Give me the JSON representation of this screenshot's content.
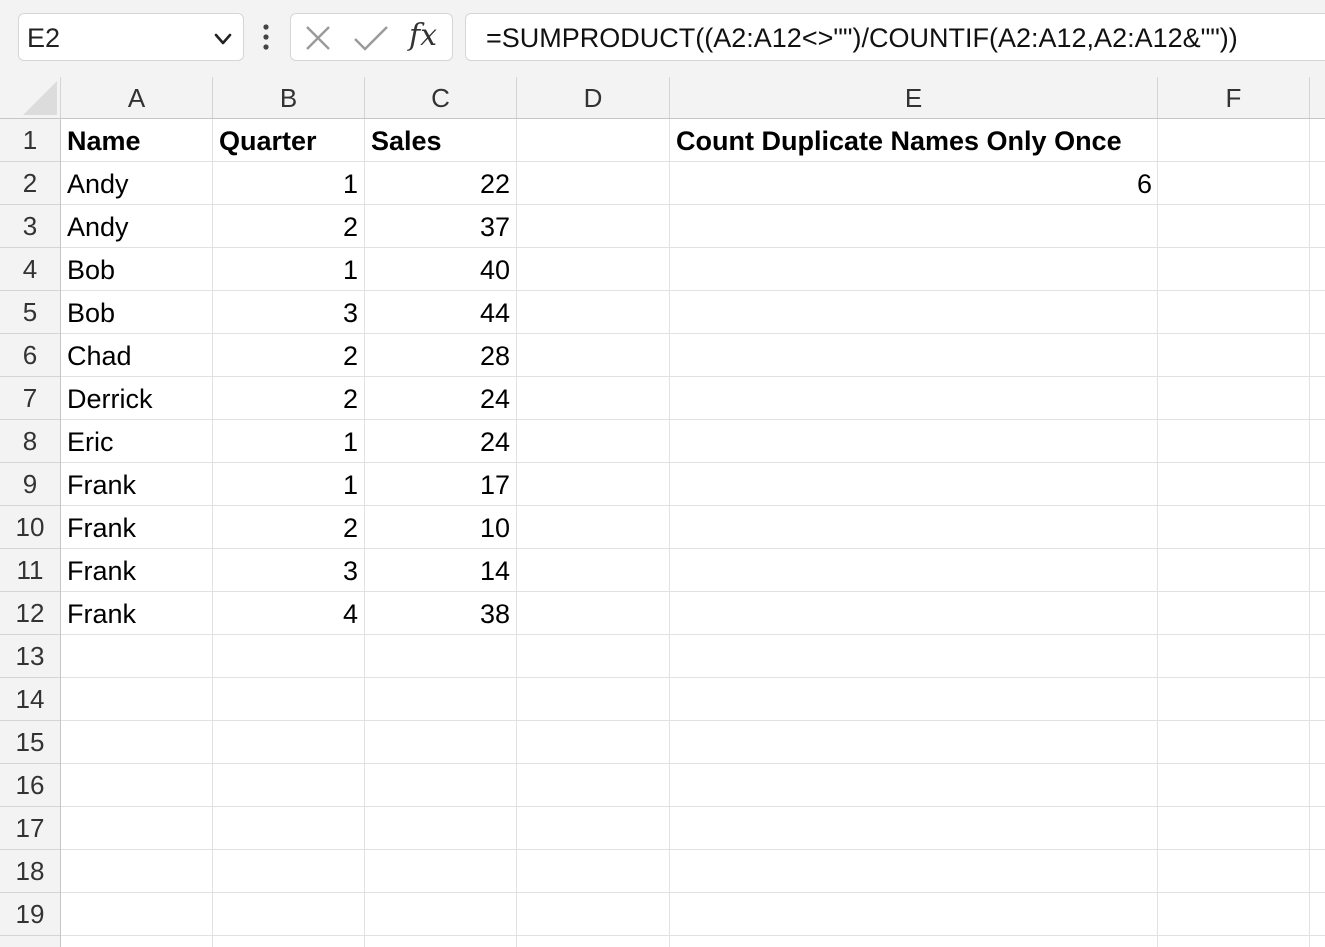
{
  "name_box": {
    "value": "E2"
  },
  "formula_bar": {
    "fx_label": "fx",
    "formula": "=SUMPRODUCT((A2:A12<>\"\")/COUNTIF(A2:A12,A2:A12&\"\"))"
  },
  "columns": [
    "A",
    "B",
    "C",
    "D",
    "E",
    "F"
  ],
  "rows": [
    "1",
    "2",
    "3",
    "4",
    "5",
    "6",
    "7",
    "8",
    "9",
    "10",
    "11",
    "12",
    "13",
    "14",
    "15",
    "16",
    "17",
    "18",
    "19"
  ],
  "headers": {
    "name": "Name",
    "quarter": "Quarter",
    "sales": "Sales",
    "e1": "Count Duplicate Names Only Once"
  },
  "data_rows": [
    {
      "name": "Andy",
      "quarter": "1",
      "sales": "22"
    },
    {
      "name": "Andy",
      "quarter": "2",
      "sales": "37"
    },
    {
      "name": "Bob",
      "quarter": "1",
      "sales": "40"
    },
    {
      "name": "Bob",
      "quarter": "3",
      "sales": "44"
    },
    {
      "name": "Chad",
      "quarter": "2",
      "sales": "28"
    },
    {
      "name": "Derrick",
      "quarter": "2",
      "sales": "24"
    },
    {
      "name": "Eric",
      "quarter": "1",
      "sales": "24"
    },
    {
      "name": "Frank",
      "quarter": "1",
      "sales": "17"
    },
    {
      "name": "Frank",
      "quarter": "2",
      "sales": "10"
    },
    {
      "name": "Frank",
      "quarter": "3",
      "sales": "14"
    },
    {
      "name": "Frank",
      "quarter": "4",
      "sales": "38"
    }
  ],
  "e2_value": "6"
}
